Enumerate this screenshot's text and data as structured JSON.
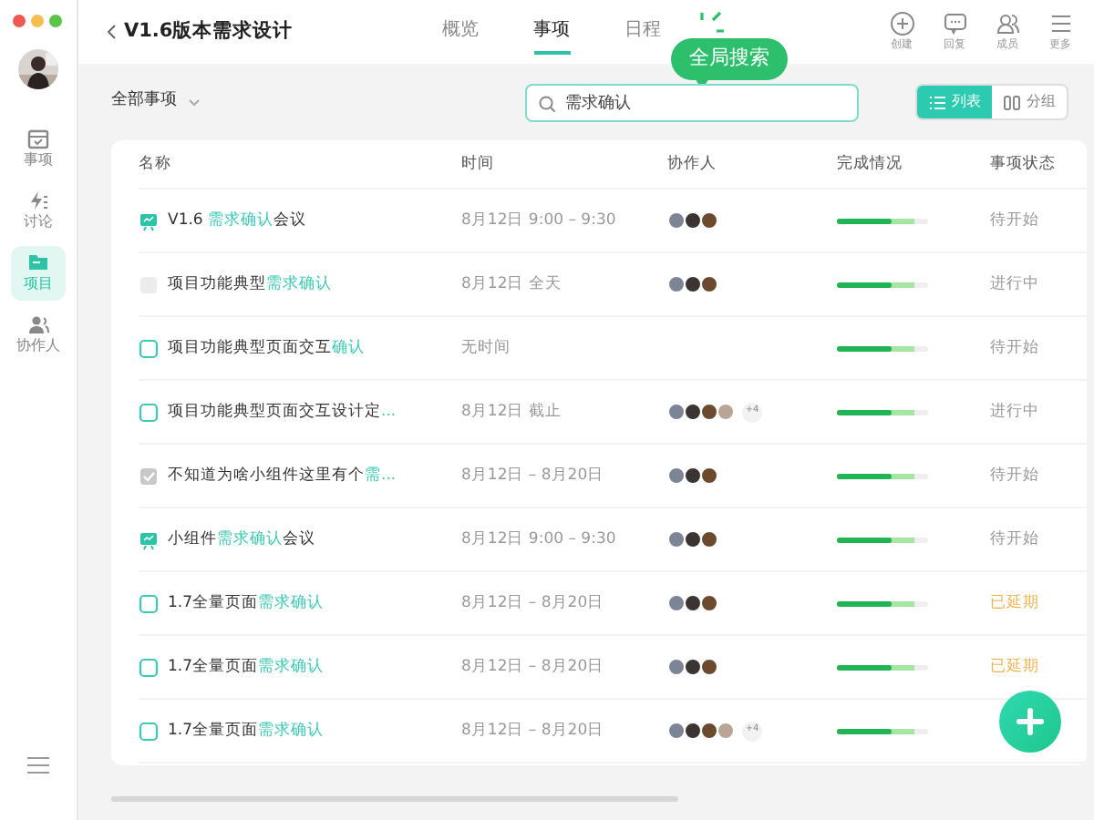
{
  "window": {
    "title": "V1.6版本需求设计"
  },
  "sidebar": {
    "items": [
      {
        "label": "事项",
        "selected": false
      },
      {
        "label": "讨论",
        "selected": false
      },
      {
        "label": "项目",
        "selected": true
      },
      {
        "label": "协作人",
        "selected": false
      }
    ]
  },
  "tabs": [
    {
      "label": "概览",
      "selected": false
    },
    {
      "label": "事项",
      "selected": true
    },
    {
      "label": "日程",
      "selected": false
    }
  ],
  "tooltip": "全局搜索",
  "actions": [
    {
      "label": "创建"
    },
    {
      "label": "回复"
    },
    {
      "label": "成员"
    },
    {
      "label": "更多"
    }
  ],
  "filter": {
    "label": "全部事项"
  },
  "search": {
    "value": "需求确认"
  },
  "view_toggle": [
    {
      "label": "列表",
      "selected": true
    },
    {
      "label": "分组",
      "selected": false
    }
  ],
  "table": {
    "columns": [
      "名称",
      "时间",
      "协作人",
      "完成情况",
      "事项状态"
    ],
    "rows": [
      {
        "kind": "meeting",
        "name": [
          {
            "text": "V1.6 ",
            "match": false
          },
          {
            "text": "需求确认",
            "match": true
          },
          {
            "text": "会议",
            "match": false
          }
        ],
        "time": "8月12日 9:00 – 9:30",
        "avatars": [
          {
            "color": "#7d8496"
          },
          {
            "color": "#3a3433"
          },
          {
            "color": "#6b4a2e"
          }
        ],
        "level": 0.6,
        "status": "待开始",
        "delayed": false
      },
      {
        "kind": "task",
        "checked": false,
        "disabled": true,
        "name": [
          {
            "text": "项目功能典型",
            "match": false
          },
          {
            "text": "需求确认",
            "match": true
          }
        ],
        "time": "8月12日 全天",
        "avatars": [
          {
            "color": "#7d8496"
          },
          {
            "color": "#3a3433"
          },
          {
            "color": "#6b4a2e"
          }
        ],
        "level": 0.6,
        "status": "进行中",
        "delayed": false
      },
      {
        "kind": "task",
        "checked": false,
        "disabled": false,
        "name": [
          {
            "text": "项目功能典型页面交互",
            "match": false
          },
          {
            "text": "确认",
            "match": true
          }
        ],
        "time": "无时间",
        "avatars": [],
        "level": 0.6,
        "status": "待开始",
        "delayed": false
      },
      {
        "kind": "task",
        "checked": false,
        "disabled": false,
        "name": [
          {
            "text": "项目功能典型页面交互设计定",
            "match": false
          },
          {
            "text": "...",
            "match": true
          }
        ],
        "time": "8月12日 截止",
        "avatars": [
          {
            "color": "#7d8496"
          },
          {
            "color": "#3a3433"
          },
          {
            "color": "#6b4a2e"
          },
          {
            "color": "#b9a596"
          }
        ],
        "more": "+4",
        "level": 0.6,
        "status": "进行中",
        "delayed": false
      },
      {
        "kind": "task",
        "checked": true,
        "disabled": true,
        "name": [
          {
            "text": "不知道为啥小组件这里有个",
            "match": false
          },
          {
            "text": "需...",
            "match": true
          }
        ],
        "time": "8月12日 – 8月20日",
        "avatars": [
          {
            "color": "#7d8496"
          },
          {
            "color": "#3a3433"
          },
          {
            "color": "#6b4a2e"
          }
        ],
        "level": 0.6,
        "status": "待开始",
        "delayed": false
      },
      {
        "kind": "meeting",
        "name": [
          {
            "text": "小组件",
            "match": false
          },
          {
            "text": "需求确认",
            "match": true
          },
          {
            "text": "会议",
            "match": false
          }
        ],
        "time": "8月12日 9:00 – 9:30",
        "avatars": [
          {
            "color": "#7d8496"
          },
          {
            "color": "#3a3433"
          },
          {
            "color": "#6b4a2e"
          }
        ],
        "level": 0.6,
        "status": "待开始",
        "delayed": false
      },
      {
        "kind": "task",
        "checked": false,
        "disabled": false,
        "name": [
          {
            "text": "1.7全量页面",
            "match": false
          },
          {
            "text": "需求确认",
            "match": true
          }
        ],
        "time": "8月12日 – 8月20日",
        "avatars": [
          {
            "color": "#7d8496"
          },
          {
            "color": "#3a3433"
          },
          {
            "color": "#6b4a2e"
          }
        ],
        "level": 0.6,
        "status": "已延期",
        "delayed": true
      },
      {
        "kind": "task",
        "checked": false,
        "disabled": false,
        "name": [
          {
            "text": "1.7全量页面",
            "match": false
          },
          {
            "text": "需求确认",
            "match": true
          }
        ],
        "time": "8月12日 – 8月20日",
        "avatars": [
          {
            "color": "#7d8496"
          },
          {
            "color": "#3a3433"
          },
          {
            "color": "#6b4a2e"
          }
        ],
        "level": 0.6,
        "status": "已延期",
        "delayed": true
      },
      {
        "kind": "task",
        "checked": false,
        "disabled": false,
        "name": [
          {
            "text": "1.7全量页面",
            "match": false
          },
          {
            "text": "需求确认",
            "match": true
          }
        ],
        "time": "8月12日 – 8月20日",
        "avatars": [
          {
            "color": "#7d8496"
          },
          {
            "color": "#3a3433"
          },
          {
            "color": "#6b4a2e"
          },
          {
            "color": "#b9a596"
          }
        ],
        "more": "+4",
        "level": 0.6
      }
    ]
  }
}
